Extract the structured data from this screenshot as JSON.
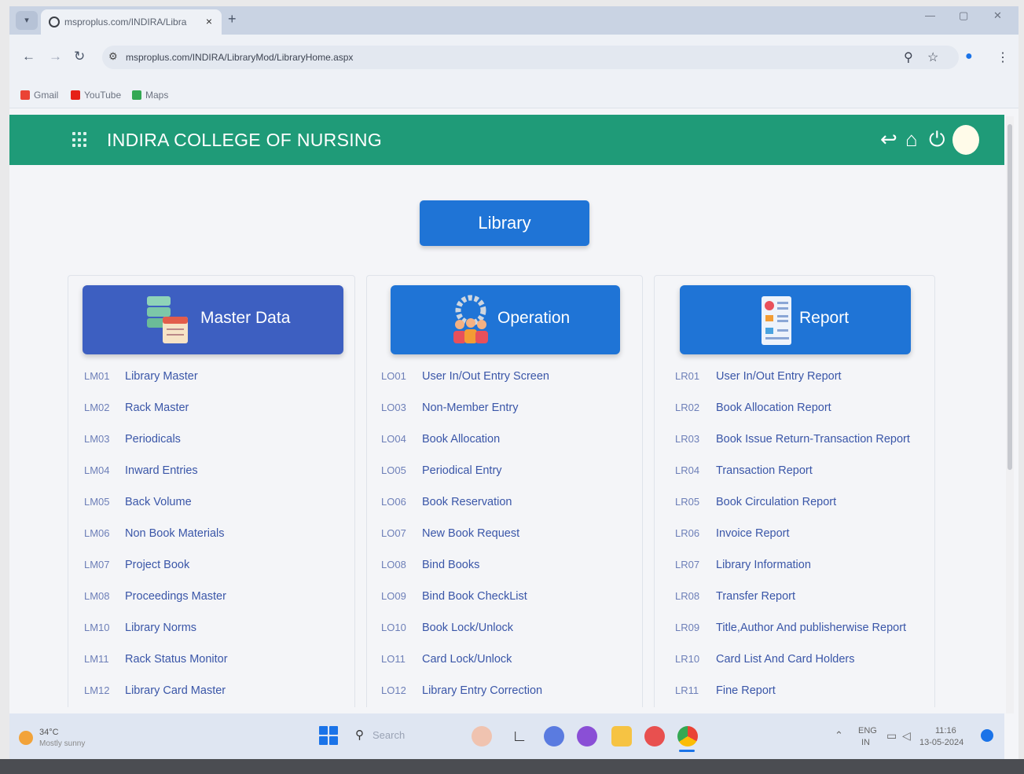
{
  "browser": {
    "tab_title": "msproplus.com/INDIRA/Libra",
    "tab_close": "×",
    "new_tab": "+",
    "url": "msproplus.com/INDIRA/LibraryMod/LibraryHome.aspx",
    "bookmarks": [
      {
        "label": "Gmail",
        "color": "#ea4335"
      },
      {
        "label": "YouTube",
        "color": "#e62117"
      },
      {
        "label": "Maps",
        "color": "#34a853"
      }
    ]
  },
  "header": {
    "title": "INDIRA COLLEGE OF NURSING",
    "color": "#1f9b78"
  },
  "library_button": "Library",
  "sections": [
    {
      "title": "Master Data",
      "color": "#3d5fc1",
      "items": [
        {
          "code": "LM01",
          "label": "Library Master"
        },
        {
          "code": "LM02",
          "label": "Rack Master"
        },
        {
          "code": "LM03",
          "label": "Periodicals"
        },
        {
          "code": "LM04",
          "label": "Inward Entries"
        },
        {
          "code": "LM05",
          "label": "Back Volume"
        },
        {
          "code": "LM06",
          "label": "Non Book Materials"
        },
        {
          "code": "LM07",
          "label": "Project Book"
        },
        {
          "code": "LM08",
          "label": "Proceedings Master"
        },
        {
          "code": "LM10",
          "label": "Library Norms"
        },
        {
          "code": "LM11",
          "label": "Rack Status Monitor"
        },
        {
          "code": "LM12",
          "label": "Library Card Master"
        }
      ]
    },
    {
      "title": "Operation",
      "color": "#1f74d6",
      "items": [
        {
          "code": "LO01",
          "label": "User In/Out Entry Screen"
        },
        {
          "code": "LO03",
          "label": "Non-Member Entry"
        },
        {
          "code": "LO04",
          "label": "Book Allocation"
        },
        {
          "code": "LO05",
          "label": "Periodical Entry"
        },
        {
          "code": "LO06",
          "label": "Book Reservation"
        },
        {
          "code": "LO07",
          "label": "New Book Request"
        },
        {
          "code": "LO08",
          "label": "Bind Books"
        },
        {
          "code": "LO09",
          "label": "Bind Book CheckList"
        },
        {
          "code": "LO10",
          "label": "Book Lock/Unlock"
        },
        {
          "code": "LO11",
          "label": "Card Lock/Unlock"
        },
        {
          "code": "LO12",
          "label": "Library Entry Correction"
        }
      ]
    },
    {
      "title": "Report",
      "color": "#1f74d6",
      "items": [
        {
          "code": "LR01",
          "label": "User In/Out Entry Report"
        },
        {
          "code": "LR02",
          "label": "Book Allocation Report"
        },
        {
          "code": "LR03",
          "label": "Book Issue Return-Transaction Report"
        },
        {
          "code": "LR04",
          "label": "Transaction Report"
        },
        {
          "code": "LR05",
          "label": "Book Circulation Report"
        },
        {
          "code": "LR06",
          "label": "Invoice Report"
        },
        {
          "code": "LR07",
          "label": "Library Information"
        },
        {
          "code": "LR08",
          "label": "Transfer Report"
        },
        {
          "code": "LR09",
          "label": "Title,Author And publisherwise Report"
        },
        {
          "code": "LR10",
          "label": "Card List And Card Holders"
        },
        {
          "code": "LR11",
          "label": "Fine Report"
        }
      ]
    }
  ],
  "taskbar": {
    "weather_temp": "34°C",
    "weather_text": "Mostly sunny",
    "search": "Search",
    "lang_1": "ENG",
    "lang_2": "IN",
    "time": "11:16",
    "date": "13-05-2024"
  }
}
